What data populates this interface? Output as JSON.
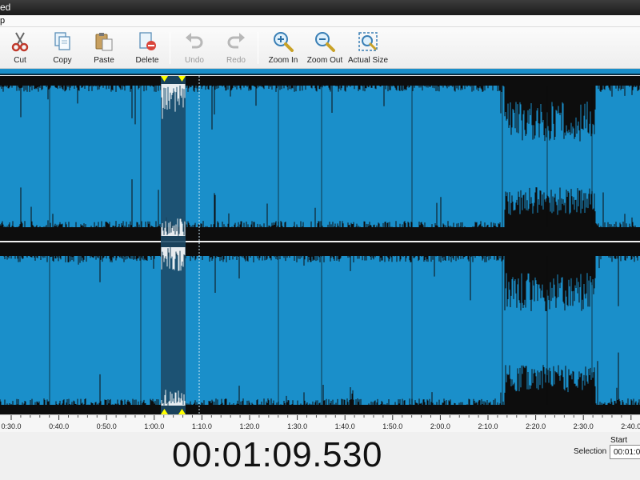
{
  "window": {
    "title_fragment": "ed"
  },
  "menu": {
    "visible_fragment": "p"
  },
  "toolbar": {
    "buttons": [
      {
        "id": "cut",
        "label": "Cut",
        "icon": "scissors-icon",
        "enabled": true
      },
      {
        "id": "copy",
        "label": "Copy",
        "icon": "copy-icon",
        "enabled": true
      },
      {
        "id": "paste",
        "label": "Paste",
        "icon": "paste-icon",
        "enabled": true
      },
      {
        "id": "delete",
        "label": "Delete",
        "icon": "delete-icon",
        "enabled": true
      },
      {
        "id": "undo",
        "label": "Undo",
        "icon": "undo-icon",
        "enabled": false
      },
      {
        "id": "redo",
        "label": "Redo",
        "icon": "redo-icon",
        "enabled": false
      },
      {
        "id": "zoom_in",
        "label": "Zoom In",
        "icon": "zoom-in-icon",
        "enabled": true
      },
      {
        "id": "zoom_out",
        "label": "Zoom Out",
        "icon": "zoom-out-icon",
        "enabled": true
      },
      {
        "id": "actual_size",
        "label": "Actual Size",
        "icon": "actual-size-icon",
        "enabled": true
      }
    ]
  },
  "waveform": {
    "channels": 2,
    "colors": {
      "waveform": "#1a8fca",
      "selection": "#1d4a66",
      "background": "#0d0d0d",
      "marker": "#ffff00"
    }
  },
  "timeline": {
    "ticks": [
      "0:30.0",
      "0:40.0",
      "0:50.0",
      "1:00.0",
      "1:10.0",
      "1:20.0",
      "1:30.0",
      "1:40.0",
      "1:50.0",
      "2:00.0",
      "2:10.0",
      "2:20.0",
      "2:30.0",
      "2:40.0"
    ]
  },
  "status": {
    "current_time": "00:01:09.530",
    "selection_label": "Selection",
    "start_label": "Start",
    "start_value": "00:01:0"
  }
}
